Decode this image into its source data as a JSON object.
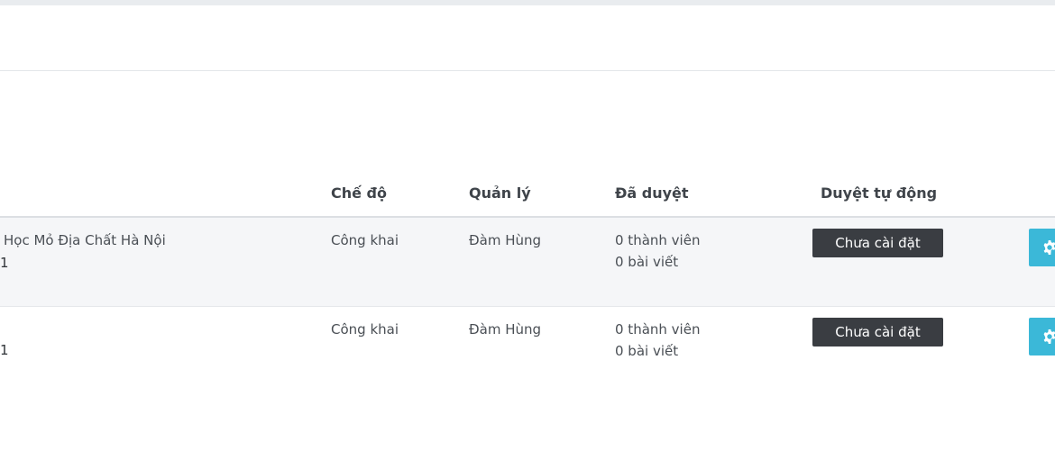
{
  "table": {
    "headers": {
      "mode": "Chế độ",
      "manager": "Quản lý",
      "approved": "Đã duyệt",
      "auto_approve": "Duyệt tự động"
    },
    "rows": [
      {
        "name": "Học Mỏ Địa Chất Hà Nội",
        "index": "1",
        "mode": "Công khai",
        "manager": "Đàm Hùng",
        "members": "0 thành viên",
        "posts": "0 bài viết",
        "status_button": "Chưa cài đặt",
        "action_icon": "gear-icon"
      },
      {
        "name": "",
        "index": "1",
        "mode": "Công khai",
        "manager": "Đàm Hùng",
        "members": "0 thành viên",
        "posts": "0 bài viết",
        "status_button": "Chưa cài đặt",
        "action_icon": "gear-icon"
      }
    ]
  },
  "colors": {
    "status_button_bg": "#3a3d42",
    "action_button_bg": "#3bb8d8",
    "row_alt_bg": "#f5f6f8"
  }
}
